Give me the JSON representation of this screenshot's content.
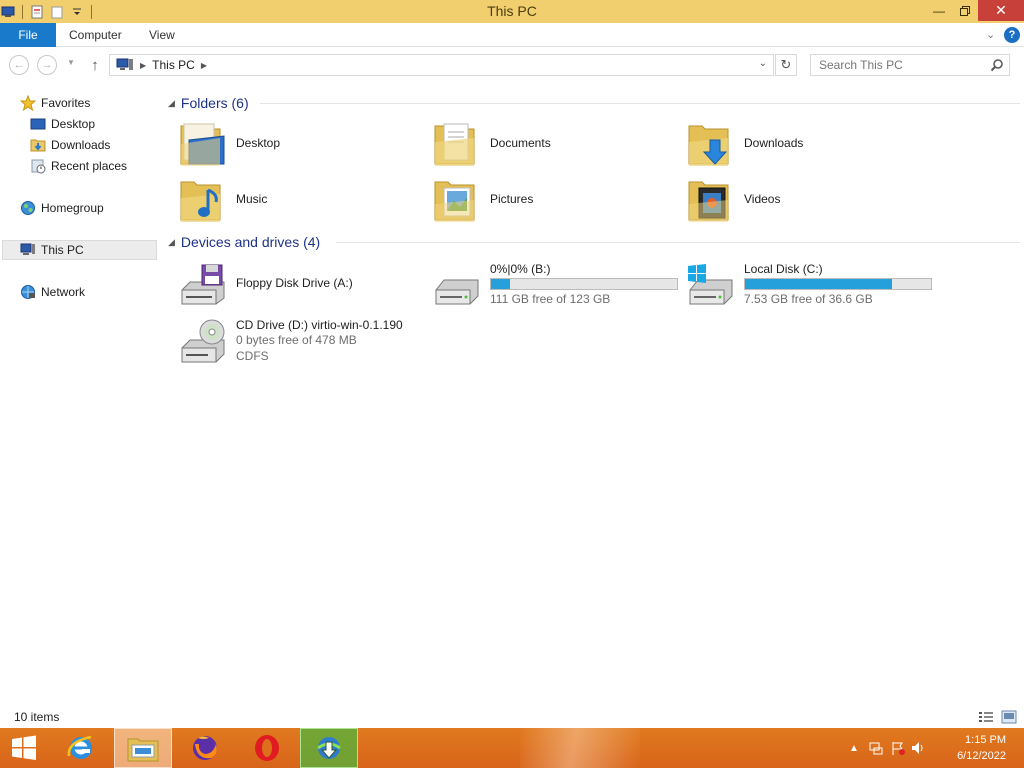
{
  "window": {
    "title": "This PC"
  },
  "ribbon": {
    "tabs": [
      "File",
      "Computer",
      "View"
    ]
  },
  "address": {
    "crumb": "This PC",
    "search_placeholder": "Search This PC"
  },
  "navpane": {
    "favorites": "Favorites",
    "items": [
      "Desktop",
      "Downloads",
      "Recent places"
    ],
    "homegroup": "Homegroup",
    "this_pc": "This PC",
    "network": "Network"
  },
  "folders": {
    "header": "Folders (6)",
    "items": [
      "Desktop",
      "Documents",
      "Downloads",
      "Music",
      "Pictures",
      "Videos"
    ]
  },
  "devices": {
    "header": "Devices and drives (4)",
    "floppy": {
      "name": "Floppy Disk Drive (A:)"
    },
    "b_drive": {
      "name": "0%|0% (B:)",
      "free": "111 GB free of 123 GB",
      "used_fraction": 0.1
    },
    "c_drive": {
      "name": "Local Disk (C:)",
      "free": "7.53 GB free of 36.6 GB",
      "used_fraction": 0.79
    },
    "cd_drive": {
      "name": "CD Drive (D:) virtio-win-0.1.190",
      "free": "0 bytes free of 478 MB",
      "fs": "CDFS"
    }
  },
  "status": {
    "count": "10 items"
  },
  "taskbar": {
    "time": "1:15 PM",
    "date": "6/12/2022"
  },
  "colors": {
    "titlebar": "#f1cf6e",
    "file_tab": "#1979ca",
    "group_header": "#1e3287",
    "bar_fill": "#26a0da",
    "taskbar": "#dc6e1c"
  }
}
